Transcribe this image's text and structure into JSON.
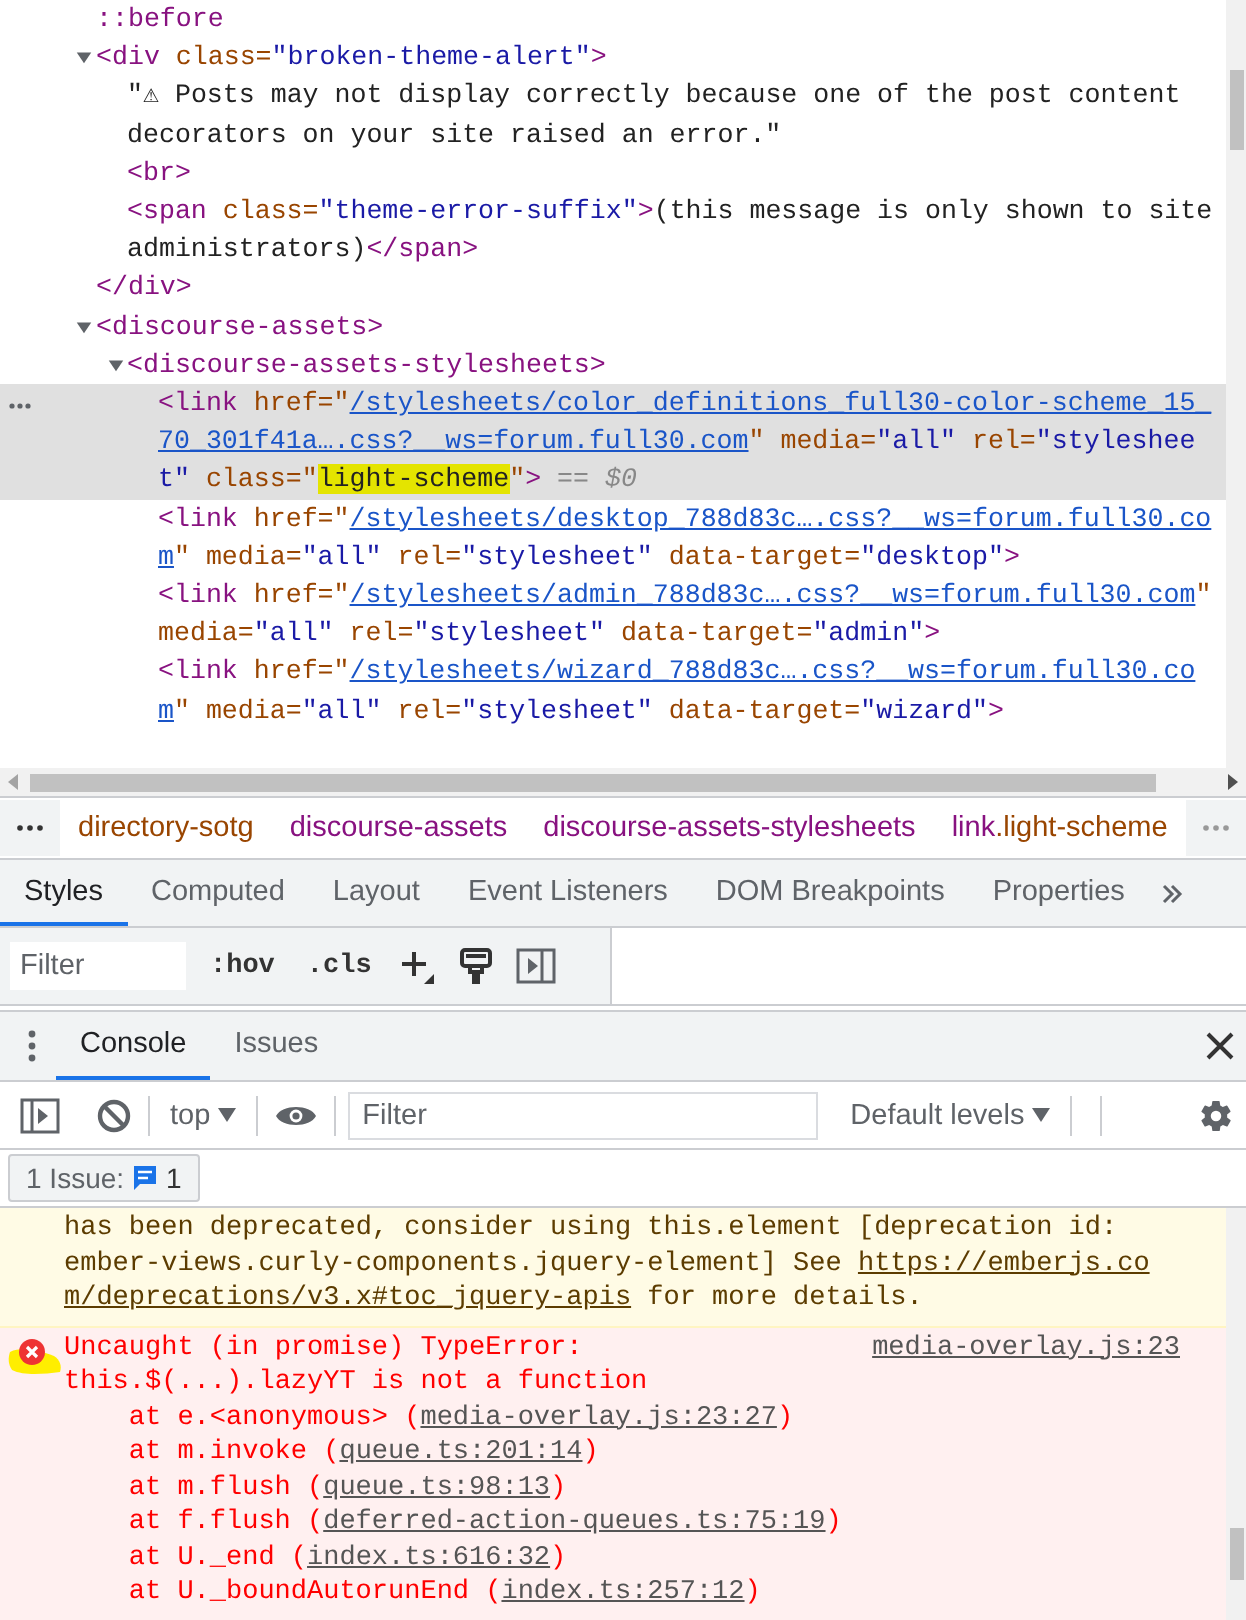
{
  "elements_tree": {
    "nodes": [
      {
        "selected": false,
        "tokens": [
          {
            "kind": "pseudo",
            "text": "::before"
          }
        ]
      },
      {
        "selected": false,
        "expanded": true,
        "tokens": [
          {
            "kind": "tag",
            "text": "<div"
          },
          {
            "kind": "attr",
            "text": " class="
          },
          {
            "kind": "value",
            "text": "\"broken-theme-alert\""
          },
          {
            "kind": "tag",
            "text": ">"
          }
        ],
        "children": [
          {
            "selected": false,
            "tokens": [
              {
                "kind": "text",
                "text": "\"⚠ Posts may not display correctly because one of the post content decorators on your site raised an error.\""
              }
            ]
          },
          {
            "selected": false,
            "tokens": [
              {
                "kind": "tag",
                "text": "<br>"
              }
            ]
          },
          {
            "selected": false,
            "tokens": [
              {
                "kind": "tag",
                "text": "<span"
              },
              {
                "kind": "attr",
                "text": " class="
              },
              {
                "kind": "value",
                "text": "\"theme-error-suffix\""
              },
              {
                "kind": "tag",
                "text": ">"
              },
              {
                "kind": "text",
                "text": "(this message is only shown to site administrators)"
              },
              {
                "kind": "tag",
                "text": "</span>"
              }
            ]
          }
        ],
        "closing": [
          {
            "kind": "tag",
            "text": "</div>"
          }
        ]
      },
      {
        "selected": false,
        "expanded": true,
        "tokens": [
          {
            "kind": "tag",
            "text": "<discourse-assets>"
          }
        ],
        "children": [
          {
            "selected": false,
            "expanded": true,
            "tokens": [
              {
                "kind": "tag",
                "text": "<discourse-assets-stylesheets>"
              }
            ],
            "children": [
              {
                "selected": true,
                "tokens": [
                  {
                    "kind": "tag",
                    "text": "<link"
                  },
                  {
                    "kind": "attr",
                    "text": " href=\""
                  },
                  {
                    "kind": "link",
                    "text": "/stylesheets/color_definitions_full30-color-scheme_15_70_301f41a….css?__ws=forum.full30.com"
                  },
                  {
                    "kind": "attr",
                    "text": "\" media="
                  },
                  {
                    "kind": "value",
                    "text": "\"all\""
                  },
                  {
                    "kind": "attr",
                    "text": " rel="
                  },
                  {
                    "kind": "value",
                    "text": "\"stylesheet\""
                  },
                  {
                    "kind": "attr",
                    "text": " class=\""
                  },
                  {
                    "kind": "highlight",
                    "text": "light-scheme"
                  },
                  {
                    "kind": "attr",
                    "text": "\""
                  },
                  {
                    "kind": "tag",
                    "text": ">"
                  },
                  {
                    "kind": "marker",
                    "text": " == $0"
                  }
                ]
              },
              {
                "selected": false,
                "tokens": [
                  {
                    "kind": "tag",
                    "text": "<link"
                  },
                  {
                    "kind": "attr",
                    "text": " href=\""
                  },
                  {
                    "kind": "link",
                    "text": "/stylesheets/desktop_788d83c….css?__ws=forum.full30.com"
                  },
                  {
                    "kind": "attr",
                    "text": "\" media="
                  },
                  {
                    "kind": "value",
                    "text": "\"all\""
                  },
                  {
                    "kind": "attr",
                    "text": " rel="
                  },
                  {
                    "kind": "value",
                    "text": "\"stylesheet\""
                  },
                  {
                    "kind": "attr",
                    "text": " data-target="
                  },
                  {
                    "kind": "value",
                    "text": "\"desktop\""
                  },
                  {
                    "kind": "tag",
                    "text": ">"
                  }
                ]
              },
              {
                "selected": false,
                "tokens": [
                  {
                    "kind": "tag",
                    "text": "<link"
                  },
                  {
                    "kind": "attr",
                    "text": " href=\""
                  },
                  {
                    "kind": "link",
                    "text": "/stylesheets/admin_788d83c….css?__ws=forum.full30.com"
                  },
                  {
                    "kind": "attr",
                    "text": "\" media="
                  },
                  {
                    "kind": "value",
                    "text": "\"all\""
                  },
                  {
                    "kind": "attr",
                    "text": " rel="
                  },
                  {
                    "kind": "value",
                    "text": "\"stylesheet\""
                  },
                  {
                    "kind": "attr",
                    "text": " data-target="
                  },
                  {
                    "kind": "value",
                    "text": "\"admin\""
                  },
                  {
                    "kind": "tag",
                    "text": ">"
                  }
                ]
              },
              {
                "selected": false,
                "tokens": [
                  {
                    "kind": "tag",
                    "text": "<link"
                  },
                  {
                    "kind": "attr",
                    "text": " href=\""
                  },
                  {
                    "kind": "link",
                    "text": "/stylesheets/wizard_788d83c….css?__ws=forum.full30.com"
                  },
                  {
                    "kind": "attr",
                    "text": "\" media="
                  },
                  {
                    "kind": "value",
                    "text": "\"all\""
                  },
                  {
                    "kind": "attr",
                    "text": " rel="
                  },
                  {
                    "kind": "value",
                    "text": "\"stylesheet\""
                  },
                  {
                    "kind": "attr",
                    "text": " data-target="
                  },
                  {
                    "kind": "value",
                    "text": "\"wizard\""
                  },
                  {
                    "kind": "tag",
                    "text": ">"
                  }
                ]
              }
            ]
          }
        ]
      }
    ]
  },
  "breadcrumbs": [
    {
      "tokens": [
        {
          "kind": "attr",
          "text": "directory-sotg"
        }
      ]
    },
    {
      "tokens": [
        {
          "kind": "tag",
          "text": "discourse-assets"
        }
      ]
    },
    {
      "tokens": [
        {
          "kind": "tag",
          "text": "discourse-assets-stylesheets"
        }
      ]
    },
    {
      "tokens": [
        {
          "kind": "tag",
          "text": "link"
        },
        {
          "kind": "attr",
          "text": ".light-scheme"
        }
      ]
    }
  ],
  "sidebar_tabs": [
    {
      "label": "Styles",
      "selected": true
    },
    {
      "label": "Computed",
      "selected": false
    },
    {
      "label": "Layout",
      "selected": false
    },
    {
      "label": "Event Listeners",
      "selected": false
    },
    {
      "label": "DOM Breakpoints",
      "selected": false
    },
    {
      "label": "Properties",
      "selected": false
    }
  ],
  "styles_toolbar": {
    "filter_placeholder": "Filter",
    "buttons": [
      ":hov",
      ".cls"
    ]
  },
  "drawer_tabs": [
    {
      "label": "Console",
      "selected": true
    },
    {
      "label": "Issues",
      "selected": false
    }
  ],
  "console_toolbar": {
    "context": "top",
    "filter_placeholder": "Filter",
    "levels": "Default levels"
  },
  "issues_button": {
    "label": "1 Issue:",
    "count": "1"
  },
  "console_messages": [
    {
      "kind": "warning",
      "tokens": [
        {
          "kind": "text",
          "text": "has been deprecated, consider using this.element [deprecation id: ember-views.curly-components.jquery-element] See "
        },
        {
          "kind": "link",
          "text": "https://emberjs.com/deprecations/v3.x#toc_jquery-apis"
        },
        {
          "kind": "text",
          "text": " for more details."
        }
      ]
    },
    {
      "kind": "error",
      "message": "Uncaught (in promise) TypeError: this.$(...).lazyYT is not a function",
      "source": "media-overlay.js:23",
      "stack": [
        {
          "before": "at e.<anonymous> (",
          "link": "media-overlay.js:23:27",
          "after": ")"
        },
        {
          "before": "at m.invoke (",
          "link": "queue.ts:201:14",
          "after": ")"
        },
        {
          "before": "at m.flush (",
          "link": "queue.ts:98:13",
          "after": ")"
        },
        {
          "before": "at f.flush (",
          "link": "deferred-action-queues.ts:75:19",
          "after": ")"
        },
        {
          "before": "at U._end (",
          "link": "index.ts:616:32",
          "after": ")"
        },
        {
          "before": "at U._boundAutorunEnd (",
          "link": "index.ts:257:12",
          "after": ")"
        }
      ]
    }
  ]
}
